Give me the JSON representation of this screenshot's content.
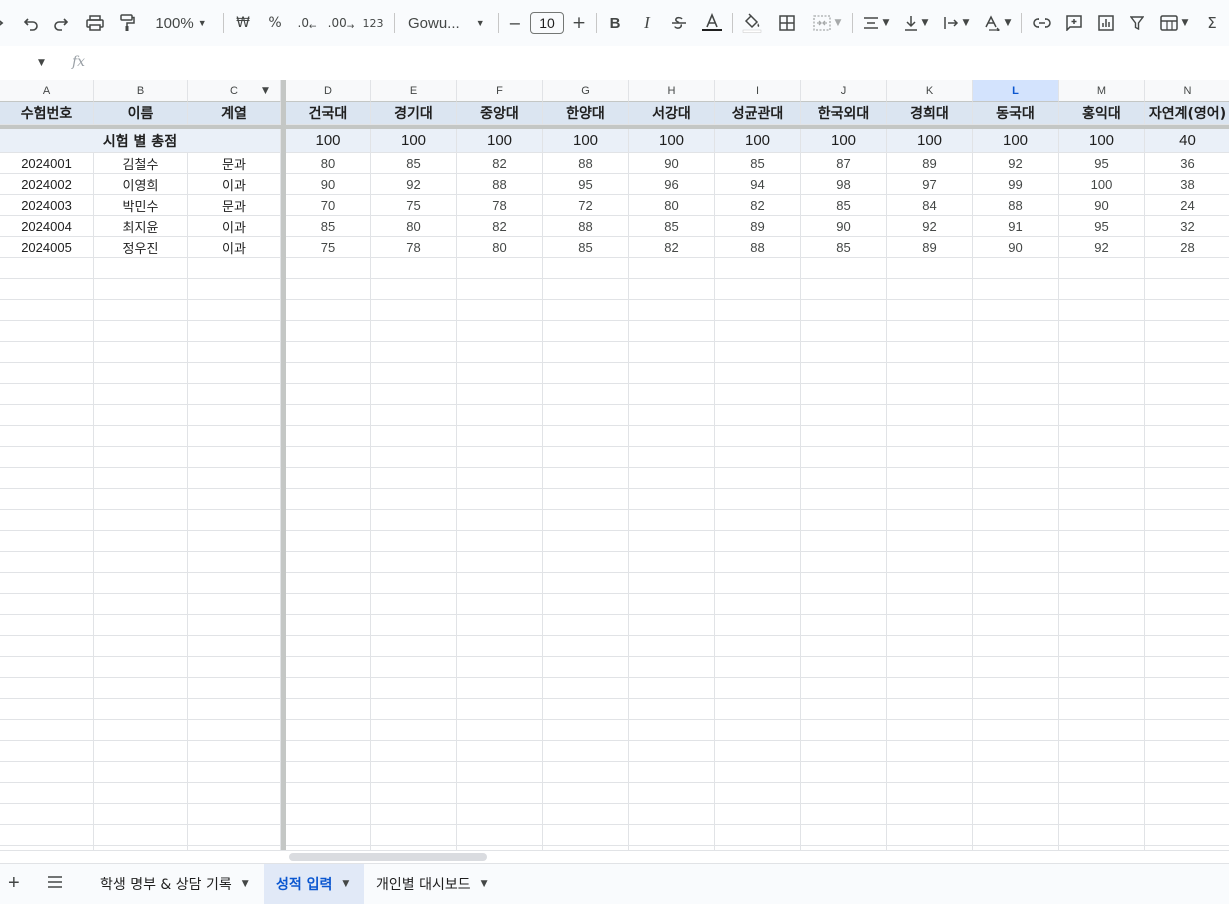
{
  "toolbar": {
    "zoom": "100%",
    "currency": "₩",
    "percent": "%",
    "dec_decrease": ".0",
    "dec_increase": ".00",
    "number_format": "123",
    "font_name": "Gowu...",
    "font_size": "10",
    "minus": "−",
    "plus": "+",
    "bold": "B",
    "italic": "I",
    "sum": "Σ"
  },
  "formula_bar": {
    "fx": "fx"
  },
  "columns": [
    "A",
    "B",
    "C",
    "D",
    "E",
    "F",
    "G",
    "H",
    "I",
    "J",
    "K",
    "L",
    "M",
    "N"
  ],
  "selected_column": "L",
  "header_row": [
    "수험번호",
    "이름",
    "계열",
    "건국대",
    "경기대",
    "중앙대",
    "한양대",
    "서강대",
    "성균관대",
    "한국외대",
    "경희대",
    "동국대",
    "홍익대",
    "자연계(영어)"
  ],
  "totals_row": {
    "label": "시험 별 총점",
    "values": [
      "100",
      "100",
      "100",
      "100",
      "100",
      "100",
      "100",
      "100",
      "100",
      "100",
      "40"
    ]
  },
  "students": [
    {
      "id": "2024001",
      "name": "김철수",
      "track": "문과",
      "scores": [
        "80",
        "85",
        "82",
        "88",
        "90",
        "85",
        "87",
        "89",
        "92",
        "95",
        "36"
      ]
    },
    {
      "id": "2024002",
      "name": "이영희",
      "track": "이과",
      "scores": [
        "90",
        "92",
        "88",
        "95",
        "96",
        "94",
        "98",
        "97",
        "99",
        "100",
        "38"
      ]
    },
    {
      "id": "2024003",
      "name": "박민수",
      "track": "문과",
      "scores": [
        "70",
        "75",
        "78",
        "72",
        "80",
        "82",
        "85",
        "84",
        "88",
        "90",
        "24"
      ]
    },
    {
      "id": "2024004",
      "name": "최지윤",
      "track": "이과",
      "scores": [
        "85",
        "80",
        "82",
        "88",
        "85",
        "89",
        "90",
        "92",
        "91",
        "95",
        "32"
      ]
    },
    {
      "id": "2024005",
      "name": "정우진",
      "track": "이과",
      "scores": [
        "75",
        "78",
        "80",
        "85",
        "82",
        "88",
        "85",
        "89",
        "90",
        "92",
        "28"
      ]
    }
  ],
  "sheet_tabs": [
    {
      "label": "학생 명부 & 상담 기록",
      "active": false
    },
    {
      "label": "성적 입력",
      "active": true
    },
    {
      "label": "개인별 대시보드",
      "active": false
    }
  ],
  "colors": {
    "header_fill": "#dbe5f1",
    "totals_fill": "#eaf0f8",
    "selected_column": "#d3e3fd",
    "active_tab_text": "#0b57d0"
  }
}
